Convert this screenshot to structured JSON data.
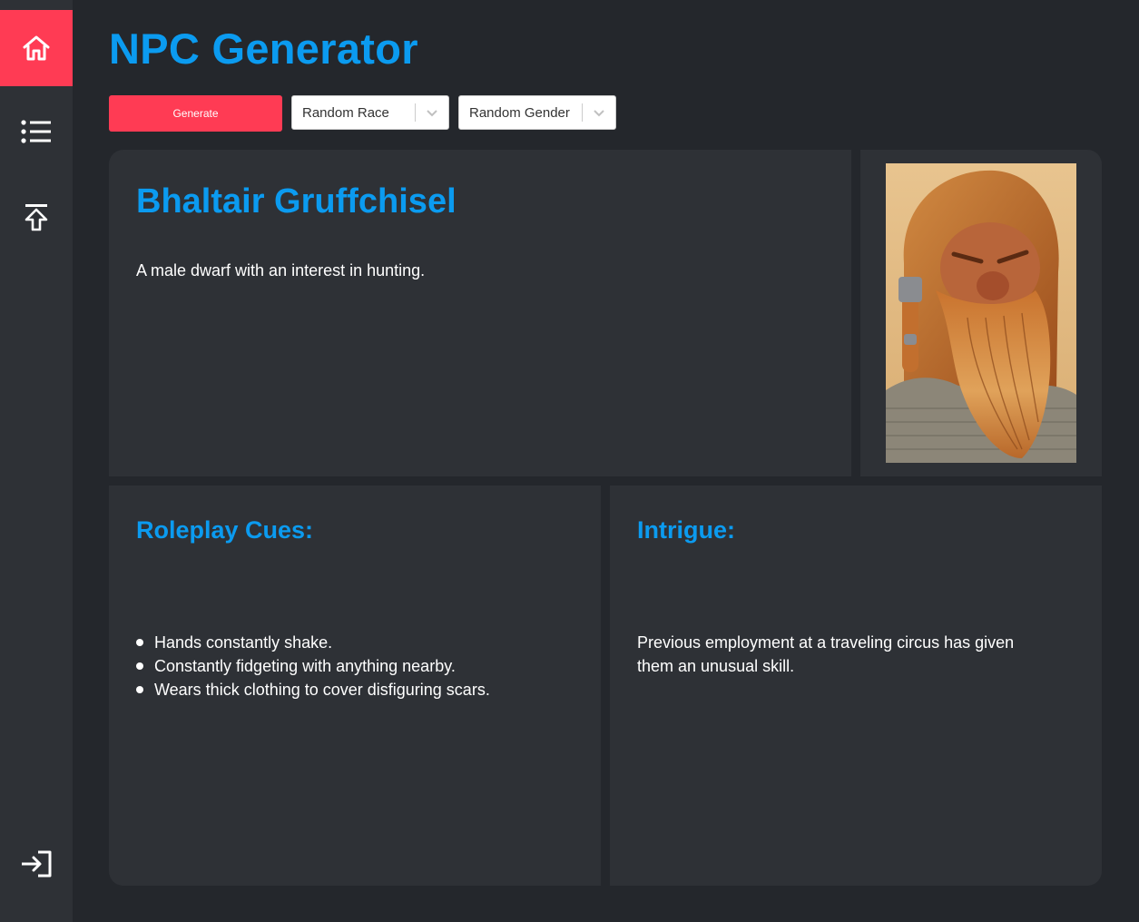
{
  "app": {
    "title": "NPC Generator"
  },
  "sidebar": {
    "items": [
      {
        "name": "home",
        "icon": "home-icon",
        "active": true
      },
      {
        "name": "list",
        "icon": "list-icon",
        "active": false
      },
      {
        "name": "upload",
        "icon": "upload-icon",
        "active": false
      }
    ],
    "footer": {
      "name": "login",
      "icon": "sign-in-icon"
    }
  },
  "toolbar": {
    "generate_label": "Generate",
    "race_select": {
      "value": "Random Race"
    },
    "gender_select": {
      "value": "Random Gender"
    }
  },
  "npc": {
    "name": "Bhaltair Gruffchisel",
    "description": "A male dwarf with an interest in hunting.",
    "portrait_icon": "dwarf-portrait-image"
  },
  "roleplay": {
    "title": "Roleplay Cues:",
    "cues": [
      "Hands constantly shake.",
      "Constantly fidgeting with anything nearby.",
      "Wears thick clothing to cover disfiguring scars."
    ]
  },
  "intrigue": {
    "title": "Intrigue:",
    "text": "Previous employment at a traveling circus has given them an unusual skill."
  },
  "colors": {
    "accent": "#ff3b54",
    "heading": "#0b9bf0",
    "background": "#24272c",
    "panel": "#2e3136"
  }
}
